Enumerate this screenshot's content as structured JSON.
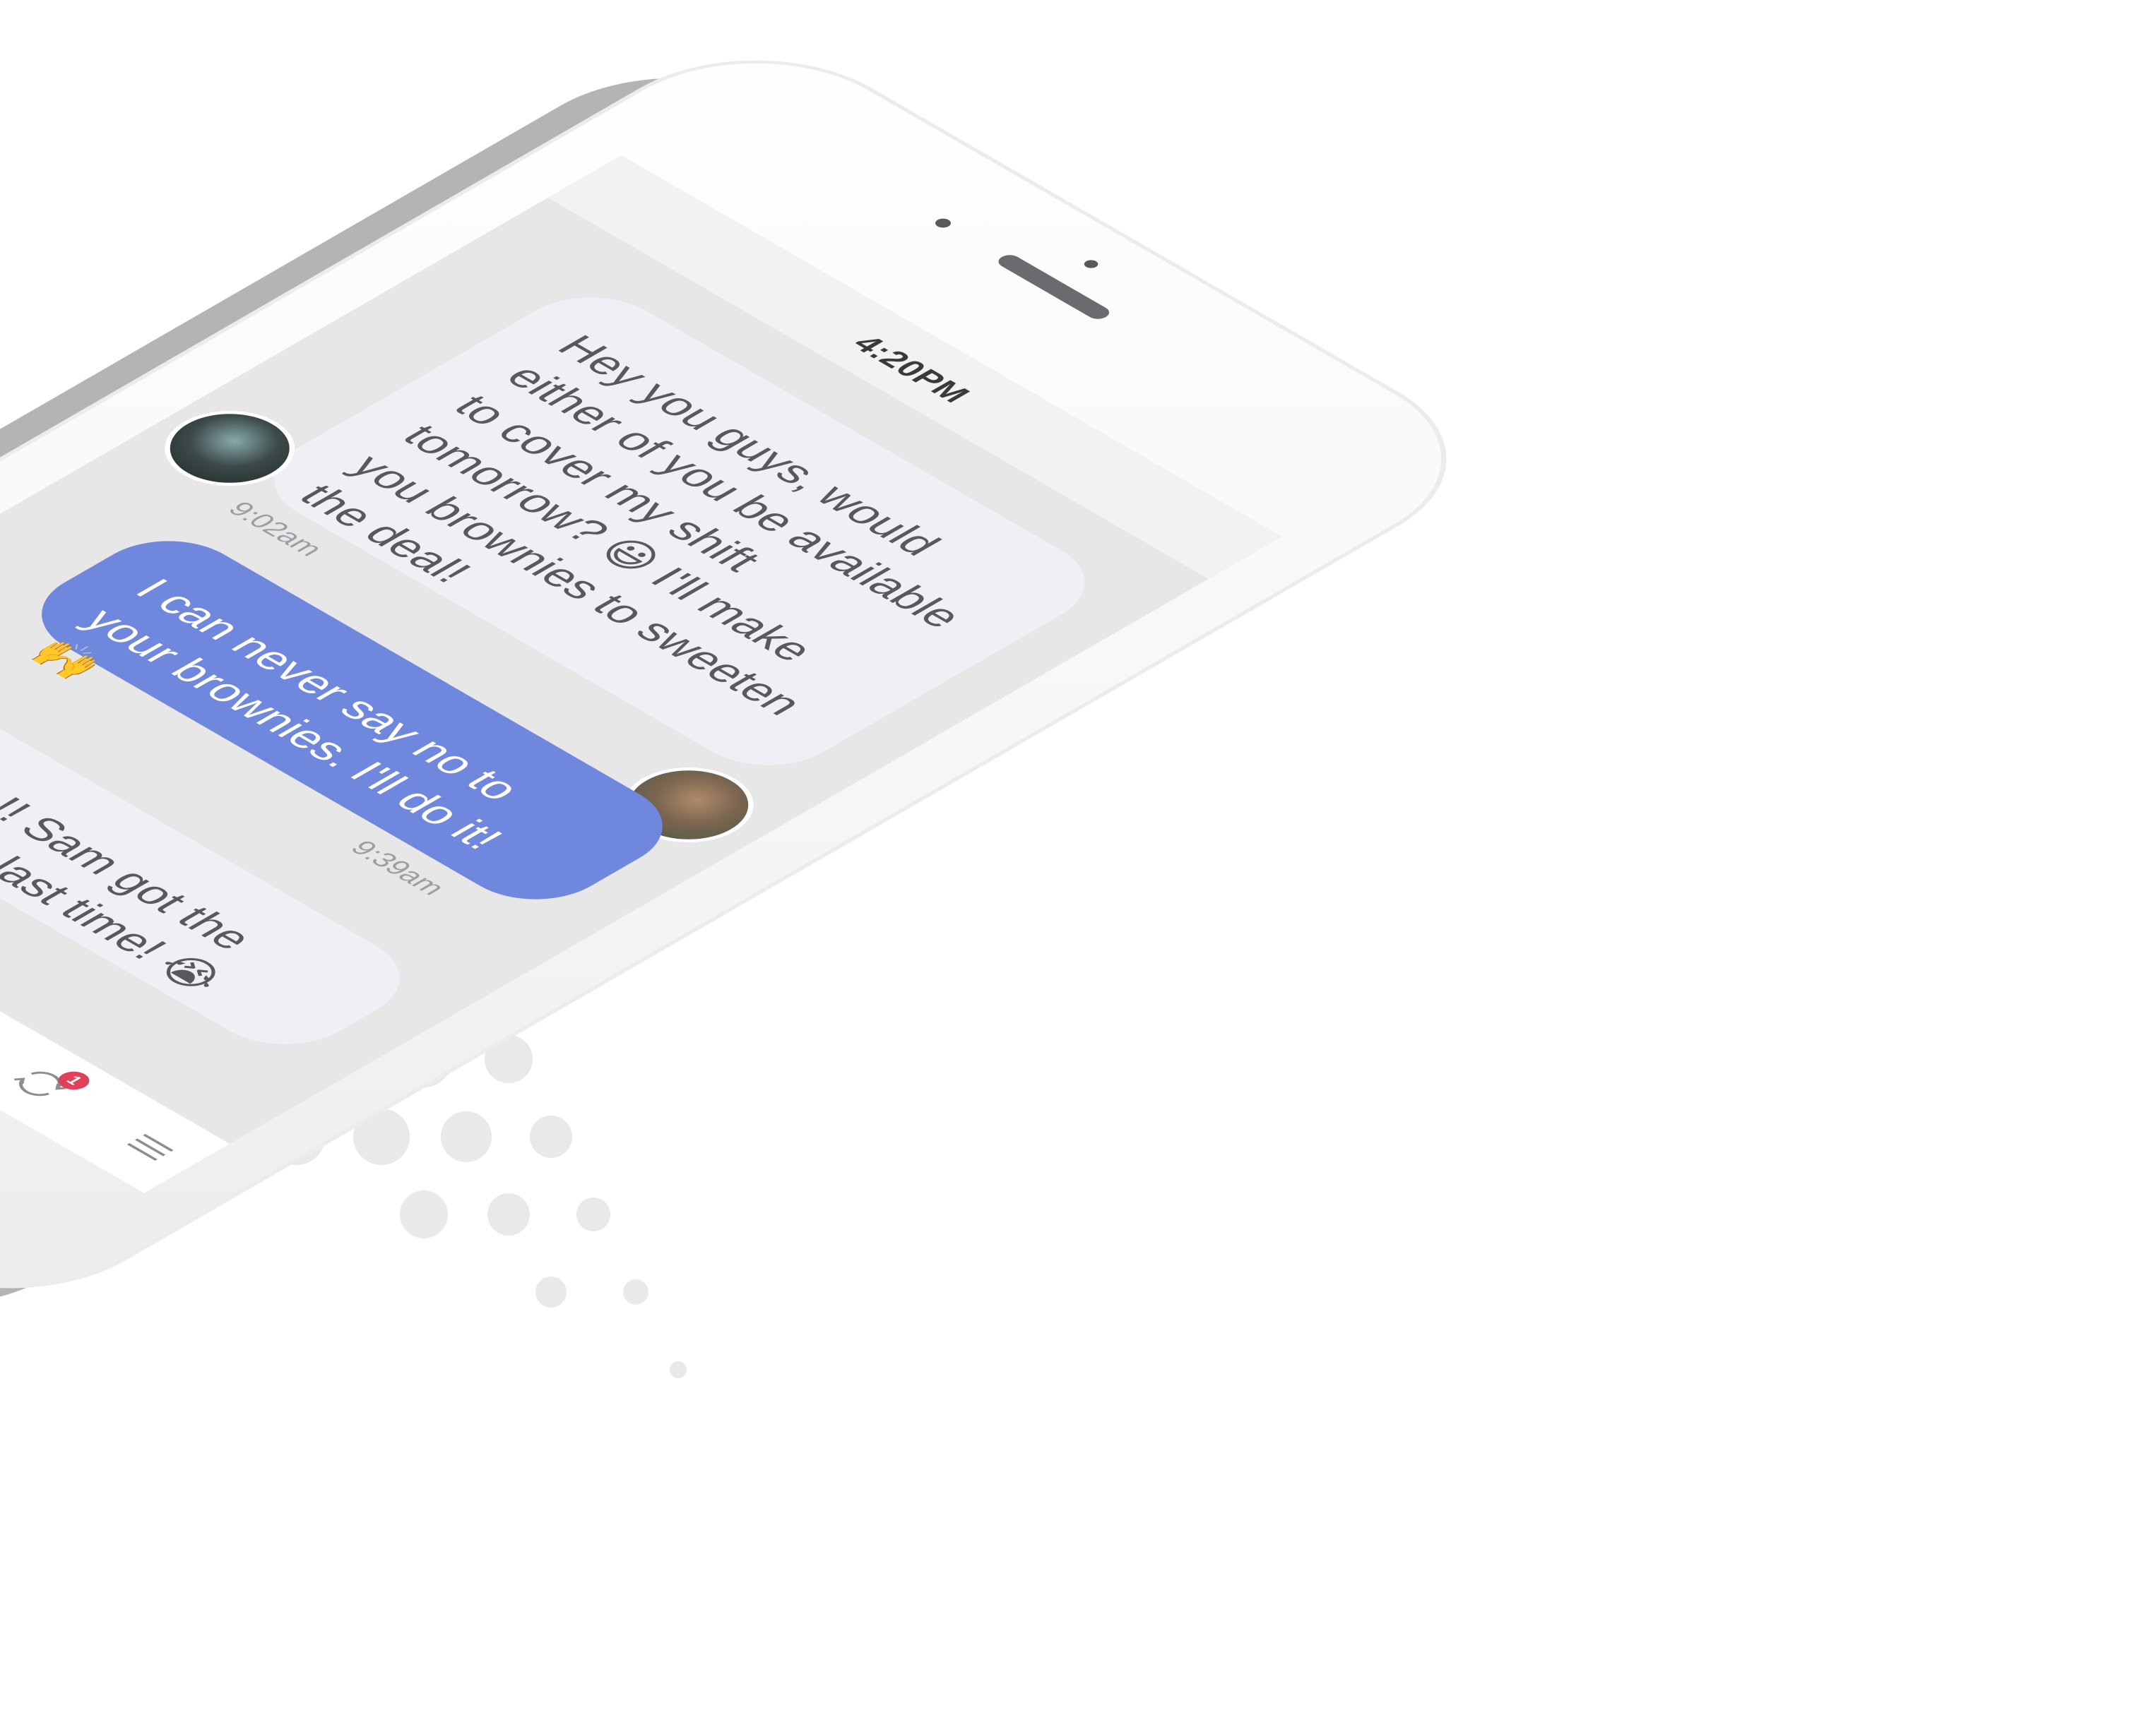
{
  "status_bar": {
    "time": "4:20PM"
  },
  "messages": [
    {
      "direction": "incoming",
      "text": "Hey you guys, would either of you be available to cover my shift tomorrow? 😃 I'll make you brownies to sweeten the deal!",
      "time": "9:02am"
    },
    {
      "direction": "outgoing",
      "text": "I can never say no to your brownies. I'll do it! 🙌",
      "time": "9:39am"
    },
    {
      "direction": "incoming",
      "text": "Noooo!! Sam got the brownies last time! 😭",
      "time": ""
    }
  ],
  "tab_bar": {
    "items": [
      {
        "icon": "profile-icon"
      },
      {
        "icon": "schedule-icon"
      },
      {
        "icon": "chat-icon"
      },
      {
        "icon": "shift-swap-icon",
        "badge": "1"
      },
      {
        "icon": "menu-icon"
      }
    ]
  },
  "colors": {
    "outgoing_bubble": "#6f87dd",
    "incoming_bubble": "#eef0f6",
    "accent": "#f06a3c",
    "badge": "#e0415a"
  }
}
